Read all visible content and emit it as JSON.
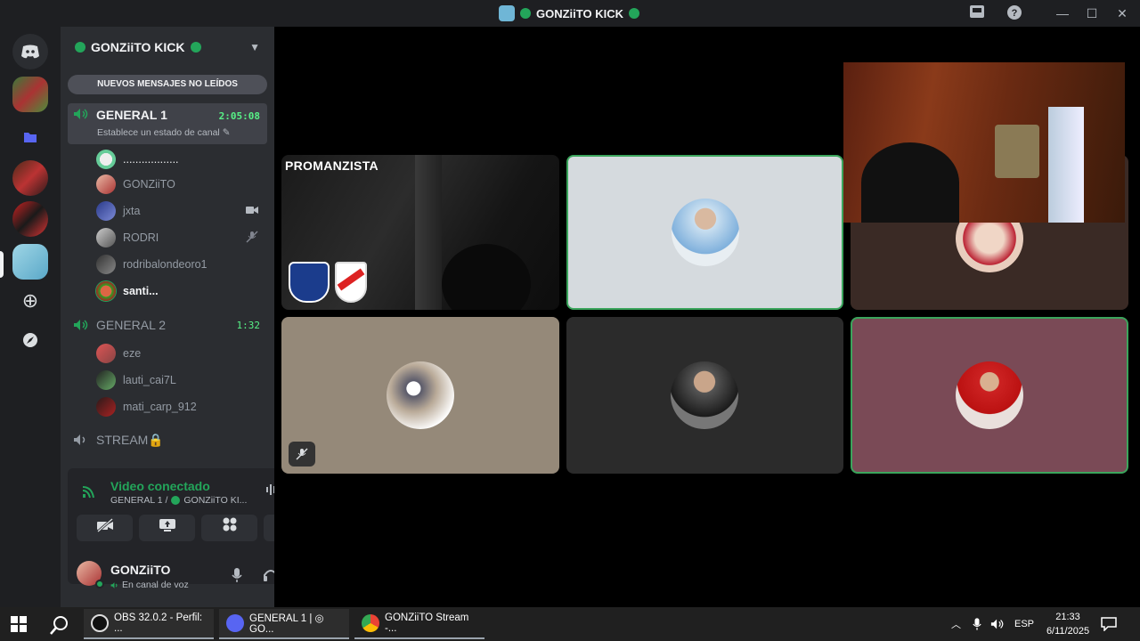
{
  "titlebar": {
    "title": "GONZiiTO KICK",
    "icons": [
      "app-icon",
      "inbox-icon",
      "help-icon",
      "minimize-icon",
      "maximize-icon",
      "close-icon"
    ]
  },
  "sidebar": {
    "guild_name": "GONZiiTO KICK",
    "unread_banner": "NUEVOS MENSAJES NO LEÍDOS",
    "channels": [
      {
        "name": "GENERAL 1",
        "time": "2:05:08",
        "status": "Establece un estado de canal"
      },
      {
        "name": "GENERAL 2",
        "time": "1:32"
      },
      {
        "name": "STREAM🔒"
      }
    ],
    "general1_members": [
      "..................",
      "GONZiiTO",
      "jxta",
      "RODRI",
      "rodribalondeoro1",
      "santi..."
    ],
    "general2_members": [
      "eze",
      "lauti_cai7L",
      "mati_carp_912"
    ]
  },
  "voice_panel": {
    "title": "Video conectado",
    "subtitle_channel": "GENERAL 1 /",
    "subtitle_server": "GONZiiTO KI...",
    "user_name": "GONZiiTO",
    "user_status": "En canal de voz"
  },
  "stage": {
    "tile_label": "PROMANZISTA"
  },
  "taskbar": {
    "items": [
      {
        "label": "OBS 32.0.2 - Perfil: ..."
      },
      {
        "label": "GENERAL 1 | ◎ GO..."
      },
      {
        "label": "GONZiiTO Stream -..."
      }
    ],
    "lang": "ESP",
    "time": "21:33",
    "date": "6/11/2025"
  },
  "colors": {
    "accent_green": "#23a55a",
    "sidebar_bg": "#2b2d31",
    "rail_bg": "#1e1f22",
    "speaking_border": "#3ba55c"
  }
}
